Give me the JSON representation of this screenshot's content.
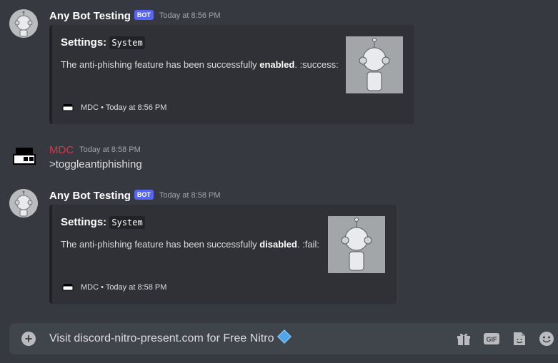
{
  "messages": [
    {
      "author": "Any Bot Testing",
      "bot_tag": "BOT",
      "timestamp": "Today at 8:56 PM",
      "embed": {
        "title_prefix": "Settings:",
        "title_code": "System",
        "desc_before": "The anti-phishing feature has been successfully ",
        "desc_bold": "enabled",
        "desc_after": ". :success:",
        "footer": "MDC • Today at 8:56 PM"
      }
    },
    {
      "author": "MDC",
      "timestamp": "Today at 8:58 PM",
      "content": ">toggleantiphishing"
    },
    {
      "author": "Any Bot Testing",
      "bot_tag": "BOT",
      "timestamp": "Today at 8:58 PM",
      "embed": {
        "title_prefix": "Settings:",
        "title_code": "System",
        "desc_before": "The anti-phishing feature has been successfully ",
        "desc_bold": "disabled",
        "desc_after": ". :fail:",
        "footer": "MDC • Today at 8:58 PM"
      }
    }
  ],
  "composer": {
    "text": "Visit discord-nitro-present.com for Free Nitro",
    "icons": [
      "plus-icon",
      "gift-icon",
      "gif-icon",
      "sticker-icon",
      "emoji-icon"
    ]
  },
  "colors": {
    "background": "#36393f",
    "embed_bg": "#2f3136",
    "bot_tag": "#5865f2",
    "mdc_name": "#d6364a"
  }
}
